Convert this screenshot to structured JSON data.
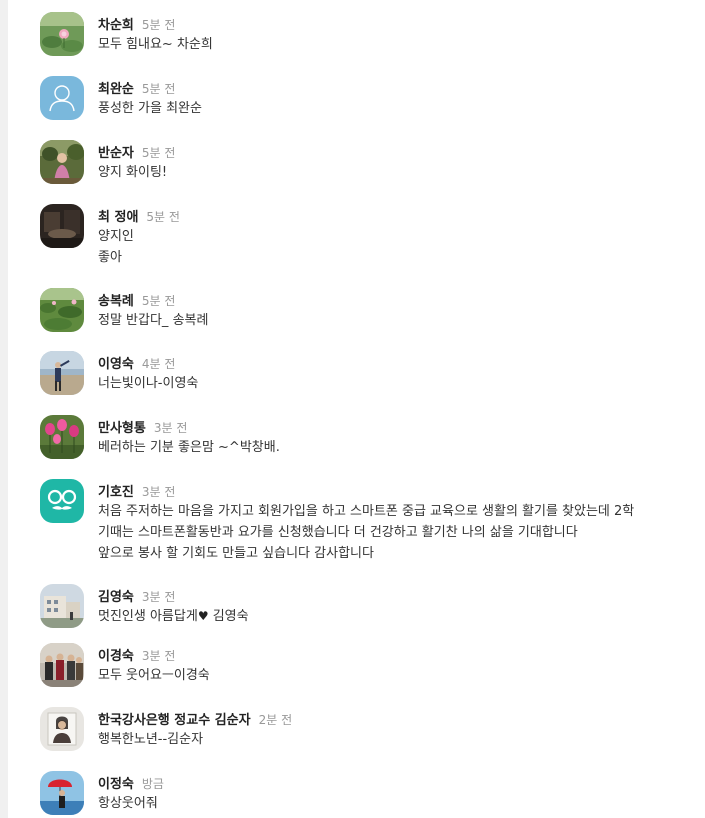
{
  "comments": [
    {
      "author": "차순희",
      "time": "5분 전",
      "lines": [
        "모두 힘내요~ 차순희"
      ],
      "avatar": "lotus-photo"
    },
    {
      "author": "최완순",
      "time": "5분 전",
      "lines": [
        "풍성한 가을 최완순"
      ],
      "avatar": "default-person-icon"
    },
    {
      "author": "반순자",
      "time": "5분 전",
      "lines": [
        "양지 화이팅!"
      ],
      "avatar": "garden-person-photo"
    },
    {
      "author": "최 정애",
      "time": "5분 전",
      "lines": [
        "양지인",
        "좋아"
      ],
      "avatar": "dark-scene-photo"
    },
    {
      "author": "송복례",
      "time": "5분 전",
      "lines": [
        "정말 반갑다_ 송복례"
      ],
      "avatar": "lotus-field-photo"
    },
    {
      "author": "이영숙",
      "time": "4분 전",
      "lines": [
        "너는빛이나-이영숙"
      ],
      "avatar": "beach-person-photo"
    },
    {
      "author": "만사형통",
      "time": "3분 전",
      "lines": [
        "베러하는 기분 좋은맘 ~^박창배."
      ],
      "avatar": "pink-tulips-photo"
    },
    {
      "author": "기호진",
      "time": "3분 전",
      "lines": [
        "처음 주저하는 마음을 가지고 회원가입을 하고 스마트폰 중급 교육으로 생활의 활기를 찾았는데 2학",
        "기때는 스마트폰활동반과 요가를 신청했습니다 더 건강하고 활기찬 나의 삶을 기대합니다",
        "앞으로 봉사 할 기회도 만들고 싶습니다 감사합니다"
      ],
      "avatar": "glasses-mustache-icon"
    },
    {
      "author": "김영숙",
      "time": "3분 전",
      "lines": [
        "멋진인생 아름답게"
      ],
      "heart_suffix": " 김영숙",
      "avatar": "building-photo"
    },
    {
      "author": "이경숙",
      "time": "3분 전",
      "lines": [
        "모두 웃어요ㅡ이경숙"
      ],
      "avatar": "group-photo"
    },
    {
      "author": "한국강사은행 정교수 김순자",
      "time": "2분 전",
      "lines": [
        "행복한노년--김순자"
      ],
      "avatar": "portrait-frame-photo"
    },
    {
      "author": "이정숙",
      "time": "방금",
      "lines": [
        "항상웃어줘"
      ],
      "avatar": "red-umbrella-photo"
    }
  ],
  "colors": {
    "name": "#222222",
    "time": "#999999",
    "default_avatar_bg": "#7ab8dc",
    "glasses_icon_bg": "#1fb7a6"
  }
}
